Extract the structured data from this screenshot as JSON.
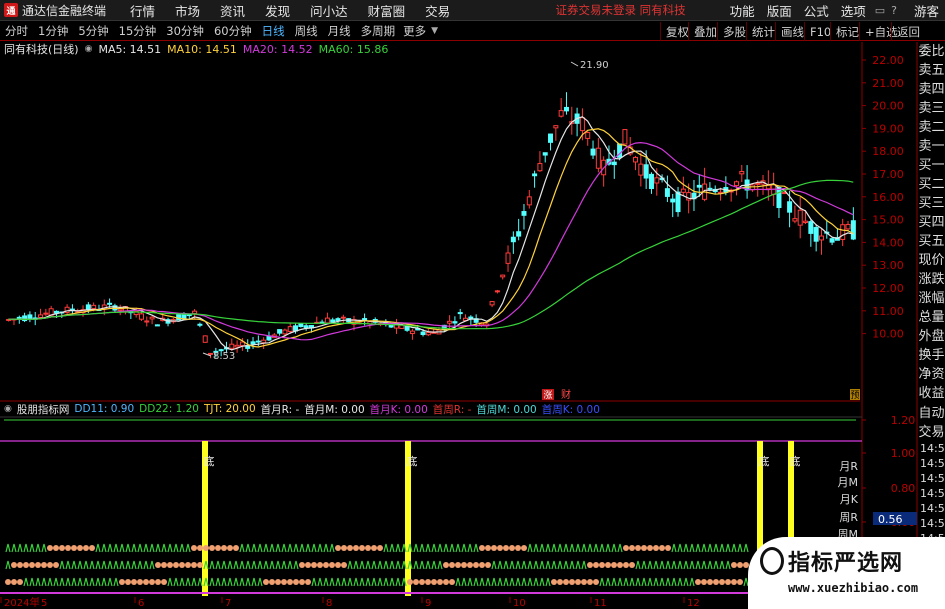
{
  "menubar": {
    "app_title": "通达信金融终端",
    "items": [
      "行情",
      "市场",
      "资讯",
      "发现",
      "问小达",
      "财富圈",
      "交易"
    ],
    "warning": "证券交易未登录   同有科技",
    "right_items": [
      "功能",
      "版面",
      "公式",
      "选项"
    ],
    "user_label": "游客"
  },
  "toolbar": {
    "periods": [
      "分时",
      "1分钟",
      "5分钟",
      "15分钟",
      "30分钟",
      "60分钟",
      "日线",
      "周线",
      "月线",
      "多周期",
      "更多"
    ],
    "active_period": "日线",
    "right_buttons": [
      "复权",
      "叠加",
      "多股",
      "统计",
      "画线",
      "F10",
      "标记",
      "+自选",
      "返回"
    ]
  },
  "main_chart": {
    "stock_label": "同有科技(日线)",
    "ma_labels": [
      {
        "text": "MA5: 14.51",
        "color": "#e6e6e6"
      },
      {
        "text": "MA10: 14.51",
        "color": "#ffd23a"
      },
      {
        "text": "MA20: 14.52",
        "color": "#d23adc"
      },
      {
        "text": "MA60: 15.86",
        "color": "#37d23a"
      }
    ],
    "y_ticks": [
      "22.00",
      "21.00",
      "20.00",
      "19.00",
      "18.00",
      "17.00",
      "16.00",
      "15.00",
      "14.00",
      "13.00",
      "12.00",
      "11.00",
      "10.00"
    ],
    "high_label": "21.90",
    "low_label": "8.53",
    "marker_up": "涨",
    "marker_cai": "财",
    "marker_yu": "预"
  },
  "right_panel": {
    "items": [
      "委比",
      "卖五",
      "卖四",
      "卖三",
      "卖二",
      "卖一",
      "买一",
      "买二",
      "买三",
      "买四",
      "买五",
      "现价",
      "涨跌",
      "涨幅",
      "总量",
      "外盘",
      "换手",
      "净资",
      "收益"
    ],
    "items2": [
      "自动",
      "交易"
    ],
    "items3": [
      "14:56",
      "14:56",
      "14:56",
      "14:56",
      "14:56",
      "14:56",
      "14:56",
      "14:56"
    ]
  },
  "indicator": {
    "name": "股朋指标网",
    "labels": [
      {
        "text": "DD11: 0.90",
        "color": "#4fb6ff"
      },
      {
        "text": "DD22: 1.20",
        "color": "#37d23a"
      },
      {
        "text": "TJT: 20.00",
        "color": "#ffd23a"
      },
      {
        "text": "首月R: -",
        "color": "#e6e6e6"
      },
      {
        "text": "首月M: 0.00",
        "color": "#e6e6e6"
      },
      {
        "text": "首月K: 0.00",
        "color": "#d23adc"
      },
      {
        "text": "首周R: -",
        "color": "#e03434"
      },
      {
        "text": "首周M: 0.00",
        "color": "#4fd6d6"
      },
      {
        "text": "首周K: 0.00",
        "color": "#3a4fff"
      }
    ],
    "y_ticks": [
      "1.20",
      "1.00",
      "0.80",
      "0.60",
      "0.40"
    ],
    "value_box": "0.56",
    "row_labels": [
      "月R",
      "月M",
      "月K",
      "周R",
      "周M",
      "周K",
      "日R"
    ],
    "bottom_label": "底"
  },
  "x_axis": {
    "labels": [
      "2024年",
      "5",
      "6",
      "7",
      "8",
      "9",
      "10",
      "11",
      "12"
    ]
  },
  "watermark": {
    "line1": "指标严选网",
    "line2": "www.xuezhibiao.com"
  }
}
